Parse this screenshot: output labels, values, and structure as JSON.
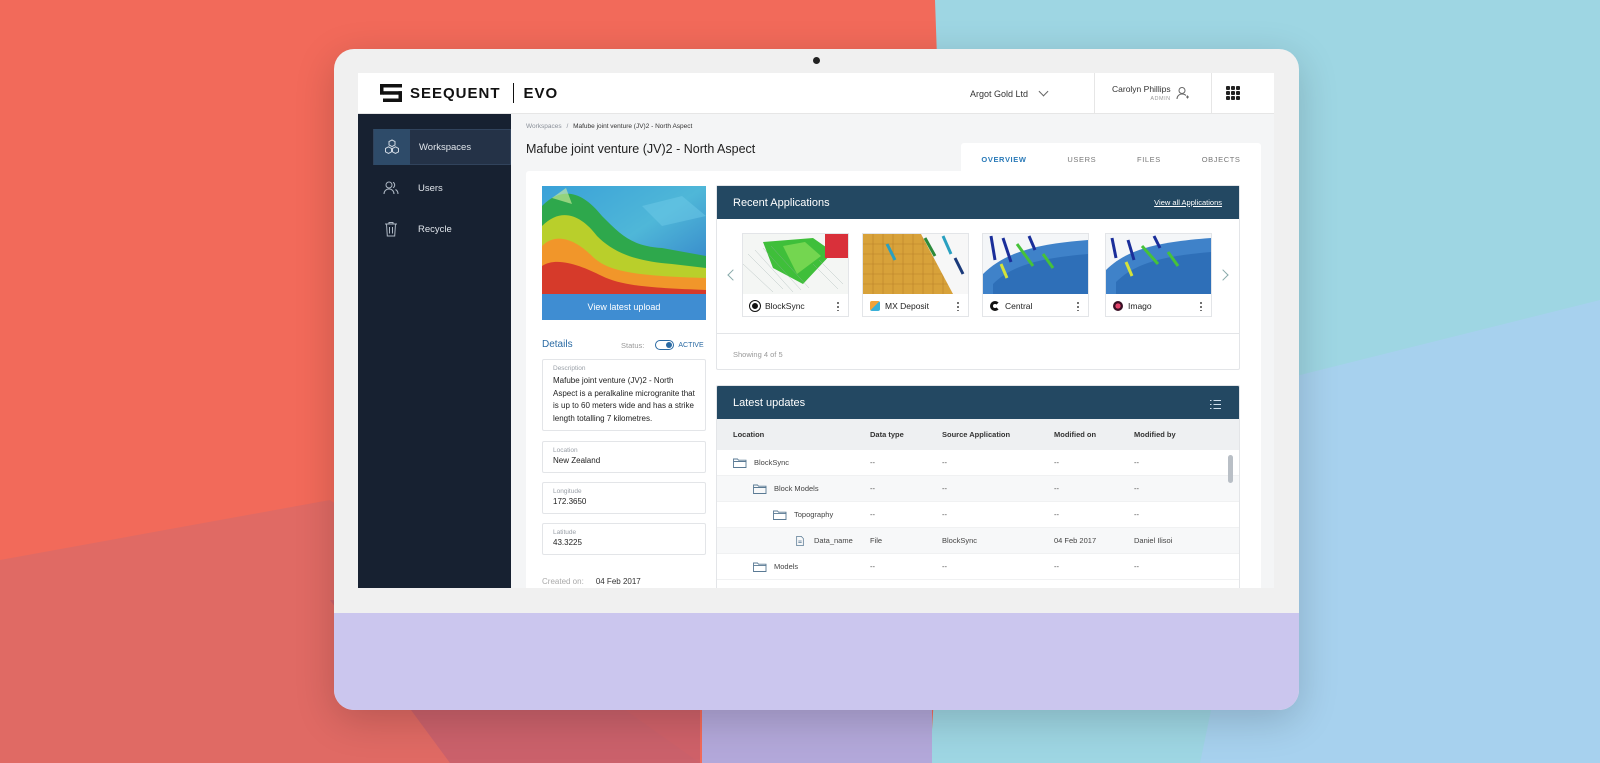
{
  "brand": {
    "logo_text": "SEEQUENT",
    "product": "EVO"
  },
  "header": {
    "organization": "Argot Gold Ltd",
    "user_name": "Carolyn Phillips",
    "user_role": "ADMIN"
  },
  "sidebar": {
    "items": [
      {
        "label": "Workspaces",
        "icon": "workspaces-icon",
        "active": true
      },
      {
        "label": "Users",
        "icon": "users-icon",
        "active": false
      },
      {
        "label": "Recycle",
        "icon": "trash-icon",
        "active": false
      }
    ]
  },
  "breadcrumb": {
    "root": "Workspaces",
    "separator": "/",
    "current": "Mafube joint venture (JV)2 - North Aspect"
  },
  "page_title": "Mafube joint venture (JV)2 - North Aspect",
  "tabs": [
    {
      "label": "OVERVIEW",
      "active": true
    },
    {
      "label": "USERS",
      "active": false
    },
    {
      "label": "FILES",
      "active": false
    },
    {
      "label": "OBJECTS",
      "active": false
    }
  ],
  "workspace": {
    "view_button": "View latest upload",
    "details_title": "Details",
    "status_label": "Status:",
    "status_value": "ACTIVE",
    "description_label": "Description",
    "description": "Mafube joint venture (JV)2 - North Aspect is a peralkaline microgranite that is up to 60 meters wide and has a strike length totalling 7 kilometres.",
    "location_label": "Location",
    "location": "New Zealand",
    "longitude_label": "Longitude",
    "longitude": "172.3650",
    "latitude_label": "Latitude",
    "latitude": "43.3225",
    "created_label": "Created on:",
    "created_on": "04 Feb 2017"
  },
  "recent_apps": {
    "title": "Recent Applications",
    "view_all": "View all Applications",
    "apps": [
      {
        "name": "BlockSync",
        "icon": "blocksync-icon"
      },
      {
        "name": "MX Deposit",
        "icon": "mx-deposit-icon"
      },
      {
        "name": "Central",
        "icon": "central-icon"
      },
      {
        "name": "Imago",
        "icon": "imago-icon"
      }
    ],
    "showing": "Showing 4 of 5"
  },
  "latest_updates": {
    "title": "Latest updates",
    "columns": [
      "Location",
      "Data type",
      "Source Application",
      "Modified on",
      "Modified by"
    ],
    "rows": [
      {
        "name": "BlockSync",
        "type": "folder",
        "depth": 0,
        "data_type": "--",
        "source": "--",
        "modified_on": "--",
        "modified_by": "--"
      },
      {
        "name": "Block Models",
        "type": "folder",
        "depth": 1,
        "data_type": "--",
        "source": "--",
        "modified_on": "--",
        "modified_by": "--"
      },
      {
        "name": "Topography",
        "type": "folder",
        "depth": 2,
        "data_type": "--",
        "source": "--",
        "modified_on": "--",
        "modified_by": "--"
      },
      {
        "name": "Data_name",
        "type": "file",
        "depth": 3,
        "data_type": "File",
        "source": "BlockSync",
        "modified_on": "04 Feb 2017",
        "modified_by": "Daniel Ilisoi"
      },
      {
        "name": "Models",
        "type": "folder",
        "depth": 1,
        "data_type": "--",
        "source": "--",
        "modified_on": "--",
        "modified_by": "--"
      }
    ]
  },
  "colors": {
    "sidebar_bg": "#172131",
    "card_header": "#234862",
    "accent": "#3f8dd2",
    "background_coral": "#f26a5a",
    "background_teal": "#9ed6e3",
    "monitor_chin": "#cbc6ee"
  }
}
